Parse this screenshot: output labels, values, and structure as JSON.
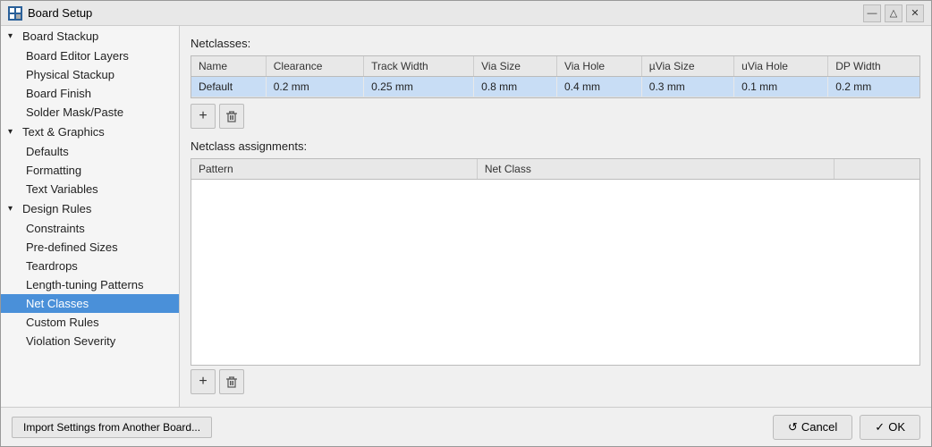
{
  "window": {
    "title": "Board Setup",
    "controls": {
      "minimize": "—",
      "maximize": "△",
      "close": "✕"
    }
  },
  "sidebar": {
    "groups": [
      {
        "id": "board-stackup",
        "label": "Board Stackup",
        "expanded": true,
        "children": [
          {
            "id": "board-editor-layers",
            "label": "Board Editor Layers"
          },
          {
            "id": "physical-stackup",
            "label": "Physical Stackup"
          },
          {
            "id": "board-finish",
            "label": "Board Finish"
          },
          {
            "id": "solder-mask-paste",
            "label": "Solder Mask/Paste"
          }
        ]
      },
      {
        "id": "text-graphics",
        "label": "Text & Graphics",
        "expanded": true,
        "children": [
          {
            "id": "defaults",
            "label": "Defaults"
          },
          {
            "id": "formatting",
            "label": "Formatting"
          },
          {
            "id": "text-variables",
            "label": "Text Variables"
          }
        ]
      },
      {
        "id": "design-rules",
        "label": "Design Rules",
        "expanded": true,
        "children": [
          {
            "id": "constraints",
            "label": "Constraints"
          },
          {
            "id": "pre-defined-sizes",
            "label": "Pre-defined Sizes"
          },
          {
            "id": "teardrops",
            "label": "Teardrops"
          },
          {
            "id": "length-tuning-patterns",
            "label": "Length-tuning Patterns"
          },
          {
            "id": "net-classes",
            "label": "Net Classes",
            "selected": true
          },
          {
            "id": "custom-rules",
            "label": "Custom Rules"
          },
          {
            "id": "violation-severity",
            "label": "Violation Severity"
          }
        ]
      }
    ]
  },
  "netclasses": {
    "section_label": "Netclasses:",
    "columns": [
      "Name",
      "Clearance",
      "Track Width",
      "Via Size",
      "Via Hole",
      "µVia Size",
      "uVia Hole",
      "DP Width"
    ],
    "rows": [
      {
        "name": "Default",
        "clearance": "0.2 mm",
        "track_width": "0.25 mm",
        "via_size": "0.8 mm",
        "via_hole": "0.4 mm",
        "uvia_size": "0.3 mm",
        "uvia_hole": "0.1 mm",
        "dp_width": "0.2 mm",
        "selected": true
      }
    ],
    "add_btn": "+",
    "delete_btn": "🗑"
  },
  "netclass_assignments": {
    "section_label": "Netclass assignments:",
    "columns": [
      "Pattern",
      "Net Class"
    ],
    "rows": [],
    "add_btn": "+",
    "delete_btn": "🗑"
  },
  "bottom": {
    "import_btn": "Import Settings from Another Board...",
    "cancel_btn": "Cancel",
    "ok_btn": "OK",
    "cancel_icon": "↺",
    "ok_icon": "✓"
  }
}
